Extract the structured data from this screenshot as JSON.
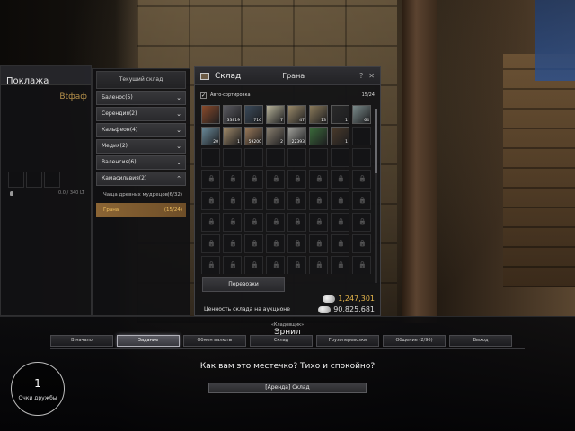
{
  "inventory": {
    "title": "Поклажа",
    "owner": "Вtфaф",
    "weight": "0.0 / 340 LT"
  },
  "cities": {
    "current_label": "Текущий склад",
    "items": [
      {
        "label": "Баленос(5)"
      },
      {
        "label": "Серендия(2)"
      },
      {
        "label": "Кальфеон(4)"
      },
      {
        "label": "Медия(2)"
      },
      {
        "label": "Валенсия(6)"
      },
      {
        "label": "Камасильвия(2)"
      }
    ],
    "sub_items": [
      {
        "label": "Чаща древних мудрецов",
        "count": "(6/32)"
      },
      {
        "label": "Грана",
        "count": "(15/24)"
      }
    ]
  },
  "storage": {
    "title": "Склад",
    "city": "Грана",
    "help": "?",
    "close": "✕",
    "autosort_label": "Авто-сортировка",
    "autosort_check": "✓",
    "capacity": "15/24",
    "items": [
      {
        "color": "#8a4a2a",
        "qty": ""
      },
      {
        "color": "#5a5a60",
        "qty": "33819"
      },
      {
        "color": "#3a4a5a",
        "qty": "716"
      },
      {
        "color": "#b8b49a",
        "qty": "7"
      },
      {
        "color": "#9a8a6a",
        "qty": "47"
      },
      {
        "color": "#8a7a5a",
        "qty": "13"
      },
      {
        "color": "#2a2a2a",
        "qty": "1"
      },
      {
        "color": "#7a8a8a",
        "qty": "64"
      },
      {
        "color": "#6a8a9a",
        "qty": "20"
      },
      {
        "color": "#a08a6a",
        "qty": "1"
      },
      {
        "color": "#9a7a5a",
        "qty": "59200"
      },
      {
        "color": "#8a8070",
        "qty": "2"
      },
      {
        "color": "#a0a09a",
        "qty": "22393"
      },
      {
        "color": "#3a6a3a",
        "qty": ""
      },
      {
        "color": "#4a3a2a",
        "qty": "1"
      }
    ],
    "transport_label": "Перевозки",
    "auction_label": "Ценность склада на аукционе",
    "silver_amount": "1,247,301",
    "auction_value": "90,825,681"
  },
  "dialog": {
    "role": "«Кладовщик»",
    "npc_name": "Эрнил",
    "tabs": [
      {
        "label": "В начало"
      },
      {
        "label": "Задание"
      },
      {
        "label": "Обмен валюты"
      },
      {
        "label": "Склад"
      },
      {
        "label": "Грузоперевозки"
      },
      {
        "label": "Общение (2/96)"
      },
      {
        "label": "Выход"
      }
    ],
    "active_tab": 1,
    "friendship_value": "1",
    "friendship_label": "Очки дружбы",
    "speech": "Как вам это местечко? Тихо и спокойно?",
    "option_label": "[Аренда] Склад"
  }
}
